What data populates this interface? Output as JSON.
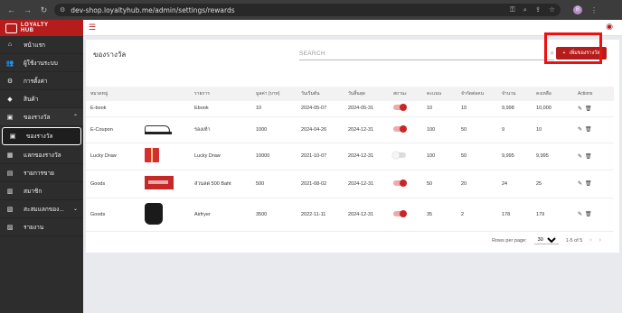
{
  "browser": {
    "url": "dev-shop.loyaltyhub.me/admin/settings/rewards",
    "profile_initial": "B"
  },
  "brand": {
    "line1": "LOYALTY",
    "line2": "HUB"
  },
  "sidebar": {
    "items": [
      {
        "label": "หน้าแรก"
      },
      {
        "label": "ผู้ใช้งานระบบ"
      },
      {
        "label": "การตั้งค่า"
      },
      {
        "label": "สินค้า"
      },
      {
        "label": "ของรางวัล"
      },
      {
        "label": "ของรางวัล"
      },
      {
        "label": "แลกของรางวัล"
      },
      {
        "label": "รายการขาย"
      },
      {
        "label": "สมาชิก"
      },
      {
        "label": "สะสมแลกของ..."
      },
      {
        "label": "รายงาน"
      }
    ]
  },
  "page": {
    "title": "ของรางวัล",
    "search_placeholder": "SEARCH",
    "add_button_label": "เพิ่มของรางวัล"
  },
  "table": {
    "headers": [
      "หมวดหมู่",
      "",
      "รายการ",
      "มูลค่า (บาท)",
      "วันเริ่มต้น",
      "วันสิ้นสุด",
      "สถานะ",
      "คะแนน",
      "จำกัดต่อคน",
      "จำนวน",
      "คงเหลือ",
      "Actions"
    ],
    "rows": [
      {
        "category": "E-book",
        "image": "",
        "item": "Ebook",
        "value": "10",
        "start": "2024-05-07",
        "end": "2024-05-31",
        "active": true,
        "points": "10",
        "limit": "10",
        "qty": "9,998",
        "remaining": "10,000"
      },
      {
        "category": "E-Coupon",
        "image": "shoe",
        "item": "รองเท้า",
        "value": "1000",
        "start": "2024-04-26",
        "end": "2024-12-31",
        "active": true,
        "points": "100",
        "limit": "50",
        "qty": "9",
        "remaining": "10"
      },
      {
        "category": "Lucky Draw",
        "image": "box",
        "item": "Lucky Draw",
        "value": "10000",
        "start": "2021-10-07",
        "end": "2024-12-31",
        "active": false,
        "points": "100",
        "limit": "50",
        "qty": "9,995",
        "remaining": "9,995"
      },
      {
        "category": "Goods",
        "image": "voucher",
        "item": "ส่วนลด 500 Baht",
        "value": "500",
        "start": "2021-08-02",
        "end": "2024-12-31",
        "active": true,
        "points": "50",
        "limit": "20",
        "qty": "24",
        "remaining": "25"
      },
      {
        "category": "Goods",
        "image": "fryer",
        "item": "Airfryer",
        "value": "3500",
        "start": "2022-11-11",
        "end": "2024-12-31",
        "active": true,
        "points": "35",
        "limit": "2",
        "qty": "178",
        "remaining": "179"
      }
    ]
  },
  "pagination": {
    "rows_per_page_label": "Rows per page:",
    "rows_per_page": "30",
    "range": "1-5 of 5"
  },
  "colors": {
    "brand": "#b71c1c",
    "sidebar": "#2d2d2d",
    "highlight": "#ee1111"
  }
}
